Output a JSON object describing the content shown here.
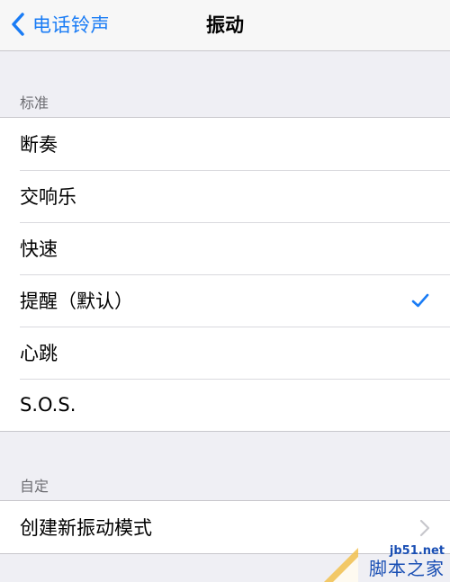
{
  "navbar": {
    "back_label": "电话铃声",
    "title": "振动"
  },
  "sections": {
    "standard": {
      "header": "标准",
      "items": [
        {
          "label": "断奏",
          "selected": false
        },
        {
          "label": "交响乐",
          "selected": false
        },
        {
          "label": "快速",
          "selected": false
        },
        {
          "label": "提醒（默认）",
          "selected": true
        },
        {
          "label": "心跳",
          "selected": false
        },
        {
          "label": "S.O.S.",
          "selected": false
        }
      ]
    },
    "custom": {
      "header": "自定",
      "items": [
        {
          "label": "创建新振动模式"
        }
      ]
    }
  },
  "watermark": {
    "url": "jb51.net",
    "name": "脚本之家"
  },
  "colors": {
    "accent": "#1a7cf5",
    "background": "#efeff4",
    "separator": "#c8c7cc",
    "section_header": "#6d6d72"
  }
}
